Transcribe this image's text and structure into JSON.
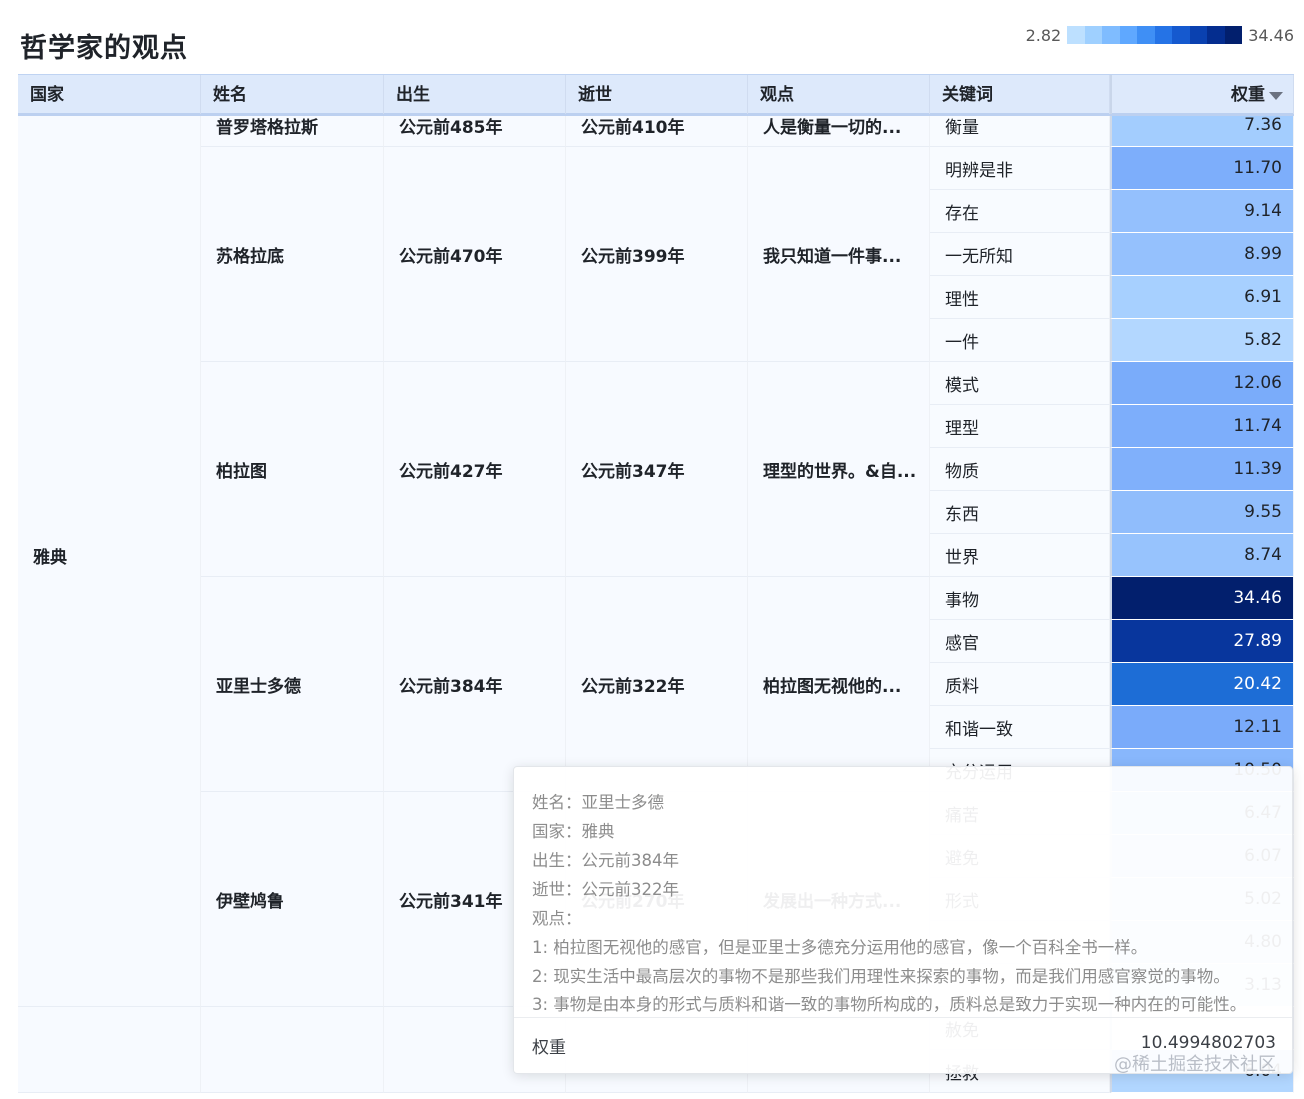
{
  "title": "哲学家的观点",
  "legend": {
    "min": "2.82",
    "max": "34.46",
    "colors": [
      "#bde0ff",
      "#9fd0ff",
      "#7fbcff",
      "#5fa8ff",
      "#3f8ff5",
      "#2573e6",
      "#1559cf",
      "#0a41b0",
      "#042d8f",
      "#021f6d"
    ]
  },
  "columns": [
    "国家",
    "姓名",
    "出生",
    "逝世",
    "观点",
    "关键词",
    "权重"
  ],
  "chart_data": {
    "type": "table",
    "title": "哲学家的观点",
    "colorScale": {
      "min": 2.82,
      "max": 34.46
    },
    "rows": [
      {
        "country": "雅典",
        "name": "普罗塔格拉斯",
        "born": "公元前485年",
        "died": "公元前410年",
        "view": "人是衡量一切的...",
        "keywords": [
          {
            "kw": "衡量",
            "w": "7.36"
          }
        ]
      },
      {
        "country": "雅典",
        "name": "苏格拉底",
        "born": "公元前470年",
        "died": "公元前399年",
        "view": "我只知道一件事...",
        "keywords": [
          {
            "kw": "明辨是非",
            "w": "11.70"
          },
          {
            "kw": "存在",
            "w": "9.14"
          },
          {
            "kw": "一无所知",
            "w": "8.99"
          },
          {
            "kw": "理性",
            "w": "6.91"
          },
          {
            "kw": "一件",
            "w": "5.82"
          }
        ]
      },
      {
        "country": "雅典",
        "name": "柏拉图",
        "born": "公元前427年",
        "died": "公元前347年",
        "view": "理型的世界。&自...",
        "keywords": [
          {
            "kw": "模式",
            "w": "12.06"
          },
          {
            "kw": "理型",
            "w": "11.74"
          },
          {
            "kw": "物质",
            "w": "11.39"
          },
          {
            "kw": "东西",
            "w": "9.55"
          },
          {
            "kw": "世界",
            "w": "8.74"
          }
        ]
      },
      {
        "country": "雅典",
        "name": "亚里士多德",
        "born": "公元前384年",
        "died": "公元前322年",
        "view": "柏拉图无视他的...",
        "keywords": [
          {
            "kw": "事物",
            "w": "34.46"
          },
          {
            "kw": "感官",
            "w": "27.89"
          },
          {
            "kw": "质料",
            "w": "20.42"
          },
          {
            "kw": "和谐一致",
            "w": "12.11"
          },
          {
            "kw": "充分运用",
            "w": "10.50"
          }
        ]
      },
      {
        "country": "雅典",
        "name": "伊壁鸠鲁",
        "born": "公元前341年",
        "died": "公元前270年",
        "view": "发展出一种方式...",
        "keywords": [
          {
            "kw": "痛苦",
            "w": "6.47"
          },
          {
            "kw": "避免",
            "w": "6.07"
          },
          {
            "kw": "形式",
            "w": "5.02"
          },
          {
            "kw": "",
            "w": "4.80"
          },
          {
            "kw": "",
            "w": "3.13"
          }
        ]
      },
      {
        "country": "",
        "name": "",
        "born": "",
        "died": "",
        "view": "",
        "keywords": [
          {
            "kw": "赦免",
            "w": ""
          },
          {
            "kw": "拯救",
            "w": "6.04"
          }
        ]
      }
    ]
  },
  "tooltip": {
    "lines": [
      "姓名：亚里士多德",
      "国家：雅典",
      "出生：公元前384年",
      "逝世：公元前322年",
      "观点：",
      "1: 柏拉图无视他的感官，但是亚里士多德充分运用他的感官，像一个百科全书一样。",
      "2: 现实生活中最高层次的事物不是那些我们用理性来探索的事物，而是我们用感官察觉的事物。",
      "3: 事物是由本身的形式与质料和谐一致的事物所构成的，质料总是致力于实现一种内在的可能性。"
    ],
    "metric_label": "权重",
    "metric_value": "10.4994802703"
  },
  "watermark": "@稀土掘金技术社区"
}
